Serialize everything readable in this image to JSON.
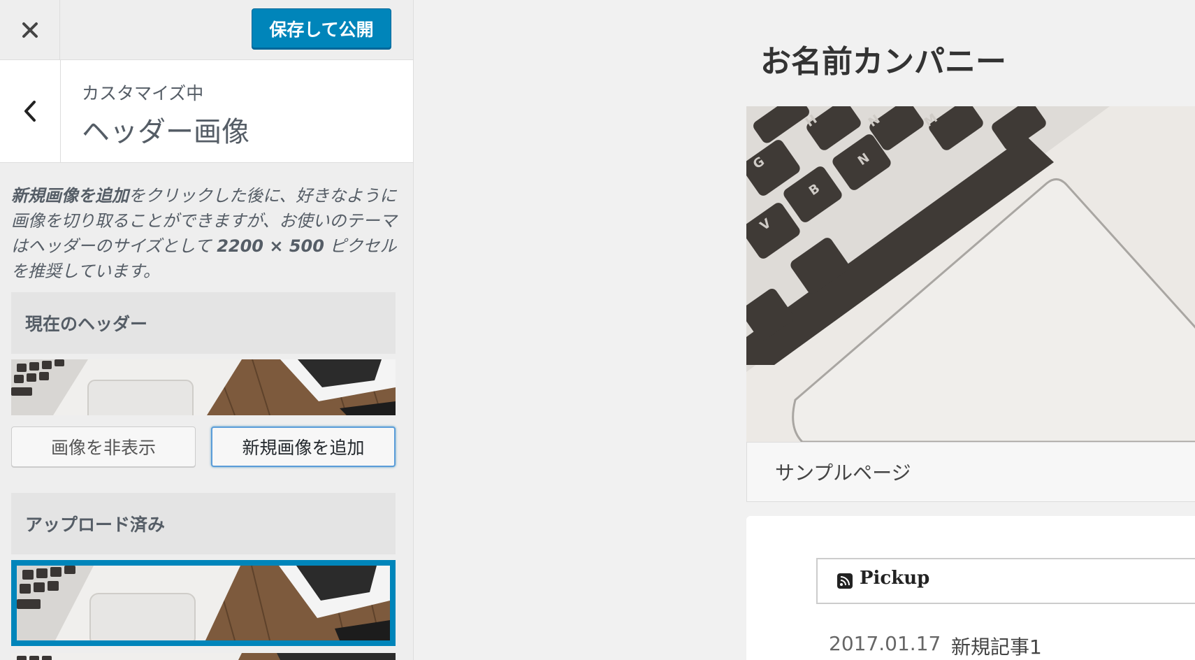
{
  "topbar": {
    "close_icon": "close-icon",
    "publish_label": "保存して公開"
  },
  "section": {
    "back_icon": "chevron-left-icon",
    "crumb": "カスタマイズ中",
    "title": "ヘッダー画像"
  },
  "description": {
    "emphasis": "新規画像を追加",
    "text_1": "をクリックした後に、好きなように画像を切り取ることができますが、お使いのテーマはヘッダーのサイズとして",
    "size": "2200 × 500",
    "text_2": "ピクセルを推奨しています。"
  },
  "current_header": {
    "heading": "現在のヘッダー",
    "hide_label": "画像を非表示",
    "add_label": "新規画像を追加"
  },
  "uploaded": {
    "heading": "アップロード済み"
  },
  "preview": {
    "site_title": "お名前カンパニー",
    "nav_item": "サンプルページ",
    "pickup_label": "Pickup",
    "post_date": "2017.01.17",
    "post_title": "新規記事1"
  },
  "colors": {
    "accent": "#0085ba",
    "sidebar_bg": "#eeeeee",
    "preview_bg": "#f1f1f1"
  }
}
